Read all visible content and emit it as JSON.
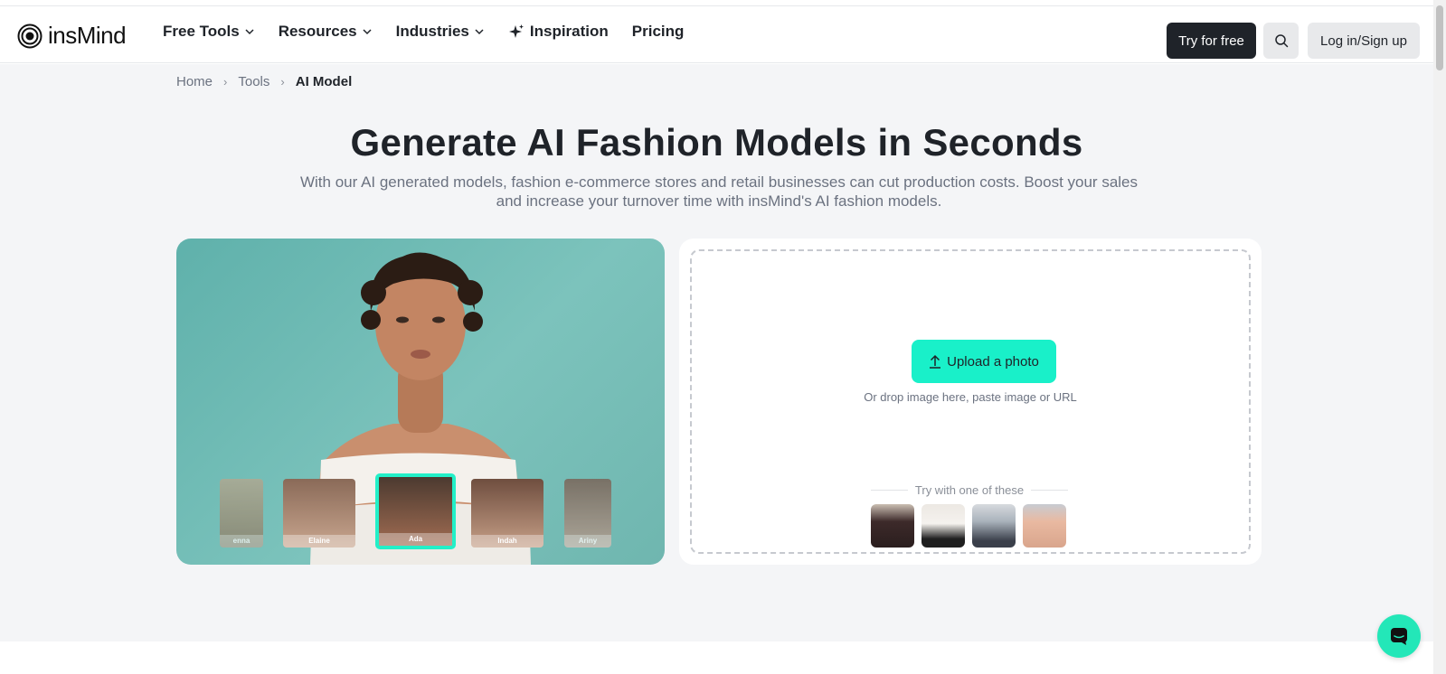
{
  "header": {
    "logo_text": "insMind",
    "nav": [
      {
        "label": "Free Tools",
        "icon": "chevron-down-icon"
      },
      {
        "label": "Resources",
        "icon": "chevron-down-icon"
      },
      {
        "label": "Industries",
        "icon": "chevron-down-icon"
      },
      {
        "label": "Inspiration",
        "icon": "sparkle-icon"
      },
      {
        "label": "Pricing"
      }
    ],
    "try_free": "Try for free",
    "login": "Log in/Sign up"
  },
  "breadcrumb": {
    "items": [
      "Home",
      "Tools"
    ],
    "current": "AI Model"
  },
  "hero": {
    "title": "Generate AI Fashion Models in Seconds",
    "subtitle": "With our AI generated models, fashion e-commerce stores and retail businesses can cut production costs. Boost your sales and increase your turnover time with insMind's AI fashion models.",
    "models": [
      "enna",
      "Elaine",
      "Ada",
      "Indah",
      "Ariny"
    ],
    "selected_model": "Ada"
  },
  "upload": {
    "button": "Upload a photo",
    "hint": "Or drop image here, paste image or URL",
    "try_label": "Try with one of these",
    "samples": [
      "sample-black-dress",
      "sample-white-tshirt",
      "sample-grey-sweater",
      "sample-peach-shirt"
    ]
  },
  "colors": {
    "accent": "#19f0c9",
    "dark": "#1f2329",
    "background": "#f4f5f7"
  }
}
